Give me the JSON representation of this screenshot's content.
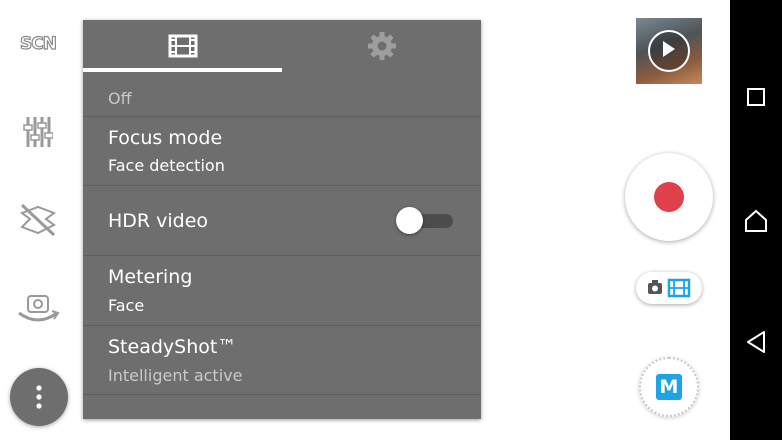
{
  "left_column": {
    "scene_label": "SCN"
  },
  "panel": {
    "tabs": [
      {
        "icon": "film-icon",
        "selected": true
      },
      {
        "icon": "gear-icon",
        "selected": false
      }
    ],
    "rows": [
      {
        "title": "",
        "value": "Off"
      },
      {
        "title": "Focus mode",
        "value": "Face detection"
      },
      {
        "title": "HDR video",
        "toggle": false
      },
      {
        "title": "Metering",
        "value": "Face"
      },
      {
        "title": "SteadyShot™",
        "value": "Intelligent active"
      }
    ]
  },
  "right_controls": {
    "mode_badge": "M",
    "record_color": "#e0404c",
    "mode_video_color": "#1ea3e4"
  },
  "navbar": {
    "buttons": [
      "recents-icon",
      "home-icon",
      "back-icon"
    ]
  }
}
